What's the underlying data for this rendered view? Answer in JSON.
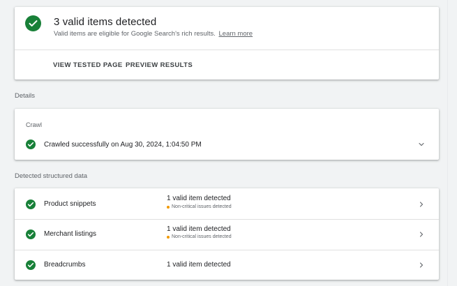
{
  "summary": {
    "title": "3 valid items detected",
    "subtitle": "Valid items are eligible for Google Search's rich results.",
    "learn_more": "Learn more",
    "actions": [
      "VIEW TESTED PAGE",
      "PREVIEW RESULTS"
    ]
  },
  "details_label": "Details",
  "crawl": {
    "heading": "Crawl",
    "status": "Crawled successfully on Aug 30, 2024, 1:04:50 PM"
  },
  "structured_label": "Detected structured data",
  "structured": [
    {
      "name": "Product snippets",
      "status": "1 valid item detected",
      "warning": "Non-critical issues detected"
    },
    {
      "name": "Merchant listings",
      "status": "1 valid item detected",
      "warning": "Non-critical issues detected"
    },
    {
      "name": "Breadcrumbs",
      "status": "1 valid item detected",
      "warning": ""
    }
  ],
  "colors": {
    "success": "#188038",
    "warning": "#f29900",
    "background": "#f1f3f4"
  }
}
